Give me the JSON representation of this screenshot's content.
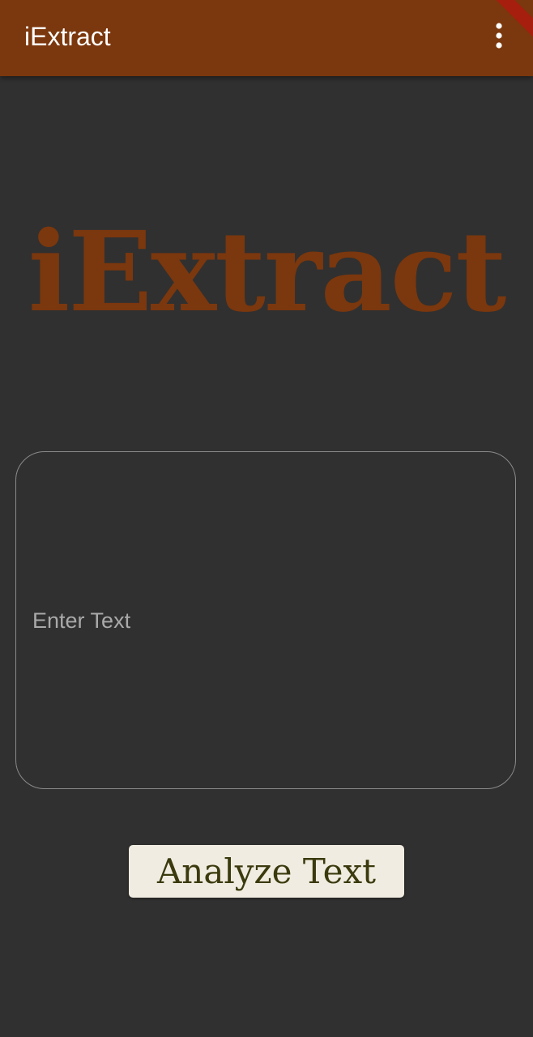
{
  "app_bar": {
    "title": "iExtract",
    "background_color": "#7B370D",
    "menu_icon": "more-vert-icon"
  },
  "logo": {
    "text": "iExtract",
    "color": "#7B370D"
  },
  "input": {
    "placeholder": "Enter Text",
    "value": ""
  },
  "actions": {
    "analyze_label": "Analyze Text"
  },
  "colors": {
    "background": "#303030",
    "button_background": "#F1ECE1",
    "button_text": "#3A3A0E"
  }
}
